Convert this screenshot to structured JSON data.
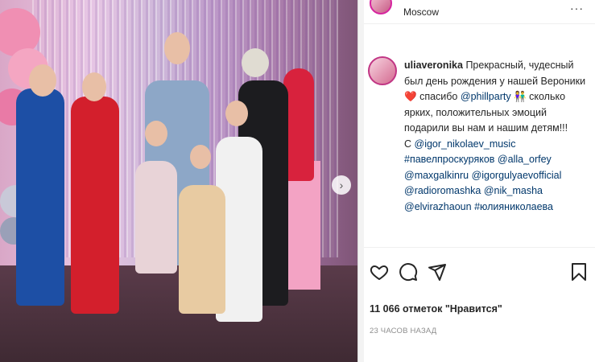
{
  "post": {
    "location": "Moscow",
    "caption": {
      "username": "uliaveronika",
      "text_1": "Прекрасный, чудесный был день рождения у нашей Вероники",
      "heart": "❤️",
      "text_2": "спасибо",
      "mention_phillparty": "@phillparty",
      "people_emoji": "👫",
      "text_3": "сколько ярких, положительных эмоций подарили вы нам и нашим детям!!!",
      "text_4": "С",
      "mention_igor": "@igor_nikolaev_music",
      "hashtag_pavel": "#павелпроскуряков",
      "mention_alla": "@alla_orfey",
      "mention_maxgalkin": "@maxgalkinru",
      "mention_igorgulyaev": "@igorgulyaevofficial",
      "mention_radioromashka": "@radioromashka",
      "mention_nikmasha": "@nik_masha",
      "mention_elvira": "@elvirazhaoun",
      "hashtag_yulia": "#юлияниколаева"
    },
    "likes_label": "11 066 отметок \"Нравится\"",
    "timestamp": "23 ЧАСОВ НАЗАД",
    "more_label": "···",
    "carousel_next_label": "›"
  },
  "icons": {
    "like": "heart-outline-icon",
    "comment": "comment-bubble-icon",
    "share": "paper-plane-icon",
    "save": "bookmark-icon"
  },
  "colors": {
    "link": "#00376b",
    "muted": "#8e8e8e",
    "text": "#262626",
    "heart": "#e0162b"
  }
}
